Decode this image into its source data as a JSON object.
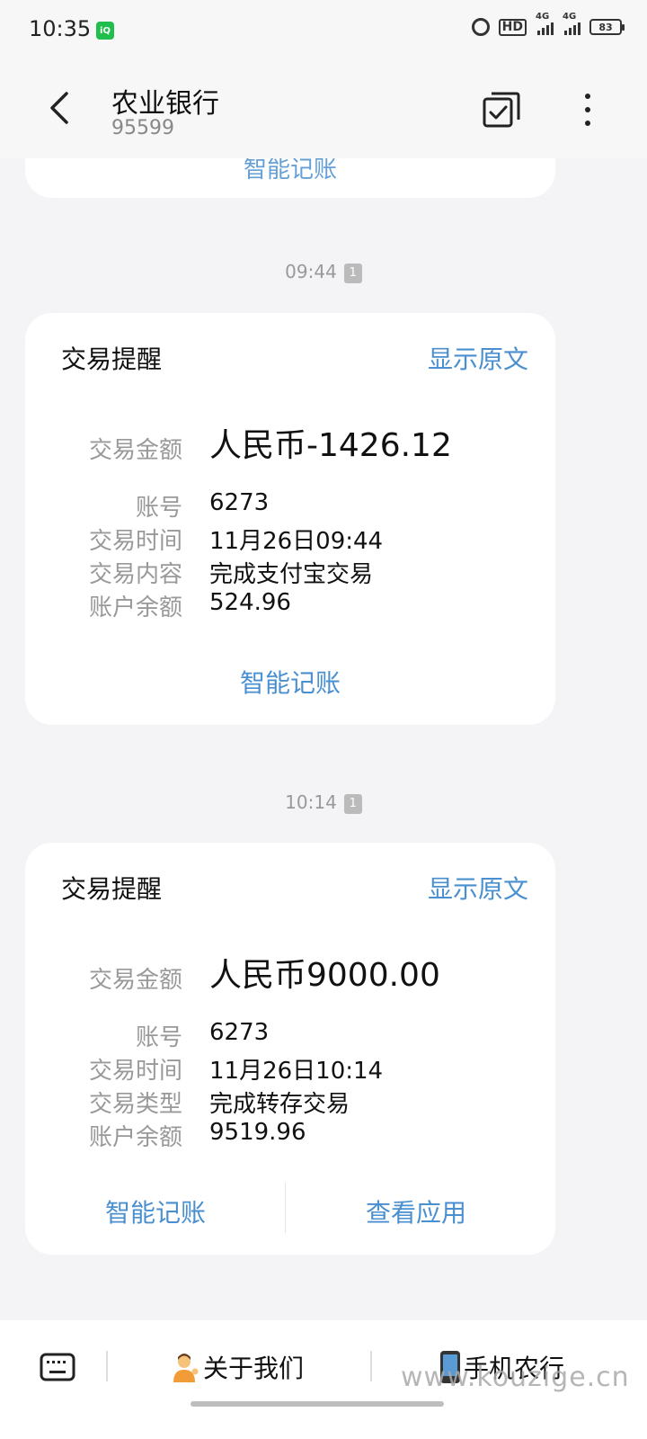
{
  "status_bar": {
    "time": "10:35",
    "app_badge": "iQIY",
    "hd_label": "HD",
    "network_1": "4G",
    "network_2": "4G",
    "battery": "83"
  },
  "header": {
    "title": "农业银行",
    "subtitle": "95599"
  },
  "previous_card": {
    "cut_text": "智能记账"
  },
  "messages": [
    {
      "timestamp": "09:44",
      "sim": "1",
      "card_title": "交易提醒",
      "show_original": "显示原文",
      "amount_label": "交易金额",
      "amount_value": "人民币-1426.12",
      "rows": [
        {
          "label": "账号",
          "value": "6273"
        },
        {
          "label": "交易时间",
          "value": "11月26日09:44"
        },
        {
          "label": "交易内容",
          "value": "完成支付宝交易"
        },
        {
          "label": "账户余额",
          "value": "524.96"
        }
      ],
      "actions": [
        "智能记账"
      ]
    },
    {
      "timestamp": "10:14",
      "sim": "1",
      "card_title": "交易提醒",
      "show_original": "显示原文",
      "amount_label": "交易金额",
      "amount_value": "人民币9000.00",
      "rows": [
        {
          "label": "账号",
          "value": "6273"
        },
        {
          "label": "交易时间",
          "value": "11月26日10:14"
        },
        {
          "label": "交易类型",
          "value": "完成转存交易"
        },
        {
          "label": "账户余额",
          "value": "9519.96"
        }
      ],
      "actions": [
        "智能记账",
        "查看应用"
      ]
    }
  ],
  "bottom_menu": {
    "items": [
      "关于我们",
      "手机农行"
    ],
    "watermark": "www.kouzige.cn"
  },
  "colors": {
    "accent": "#4a8fcf",
    "background": "#f4f4f6",
    "card": "#ffffff",
    "label_gray": "#999999"
  }
}
